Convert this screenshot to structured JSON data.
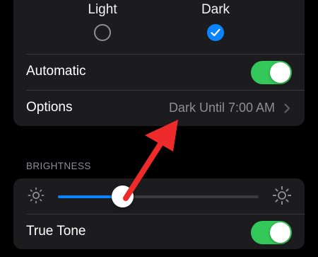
{
  "appearance": {
    "light_label": "Light",
    "dark_label": "Dark",
    "selected": "dark"
  },
  "automatic": {
    "label": "Automatic",
    "enabled": true
  },
  "options": {
    "label": "Options",
    "value": "Dark Until 7:00 AM"
  },
  "brightness": {
    "section_title": "BRIGHTNESS",
    "level": 0.32
  },
  "true_tone": {
    "label": "True Tone",
    "enabled": true
  },
  "colors": {
    "accent": "#0a84ff",
    "toggle_on": "#34c759",
    "annotation_arrow": "#ee2a2a"
  }
}
